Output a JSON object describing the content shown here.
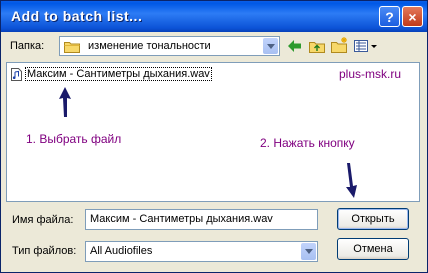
{
  "window": {
    "title": "Add to batch list..."
  },
  "lookin": {
    "label": "Папка:",
    "folder": "изменение тональности"
  },
  "files": [
    {
      "name": "Максим - Сантиметры дыхания.wav"
    }
  ],
  "annotations": {
    "watermark": "plus-msk.ru",
    "step1": "1. Выбрать файл",
    "step2": "2. Нажать кнопку"
  },
  "filename": {
    "label": "Имя файла:",
    "value": "Максим - Сантиметры дыхания.wav"
  },
  "filetype": {
    "label": "Тип файлов:",
    "value": "All Audiofiles"
  },
  "buttons": {
    "open": "Открыть",
    "cancel": "Отмена",
    "help": "?",
    "close": "×"
  },
  "colors": {
    "title_bar": "#0058e6",
    "annotation": "#800080",
    "arrow": "#1a1a6a"
  }
}
